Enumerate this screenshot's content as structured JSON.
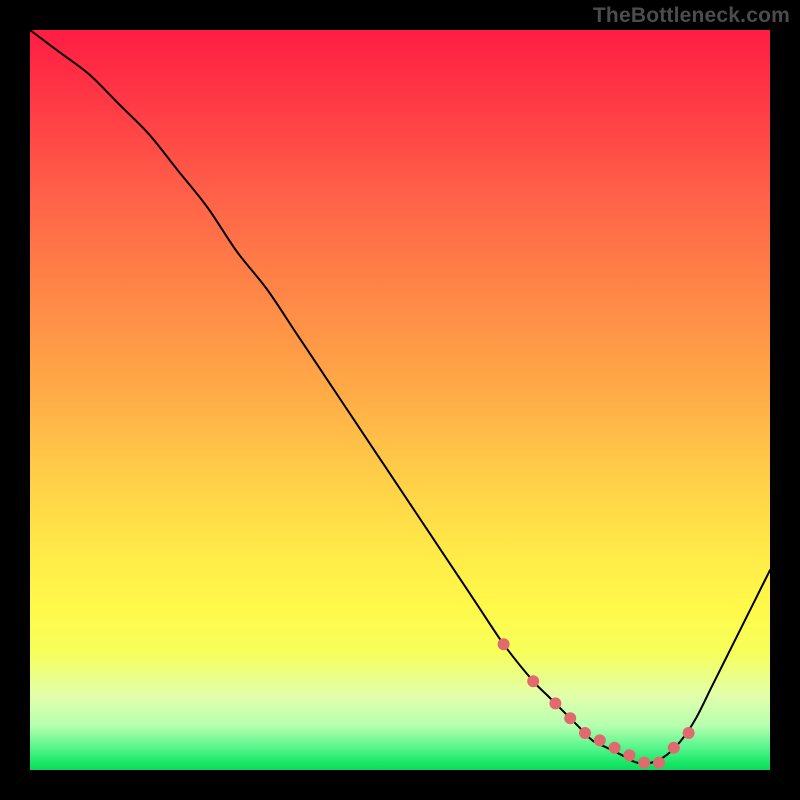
{
  "watermark": "TheBottleneck.com",
  "colors": {
    "frame_bg": "#000000",
    "curve_stroke": "#000000",
    "marker_fill": "#e06a6d",
    "gradient_top": "#ff1d44",
    "gradient_bottom": "#0fd95c"
  },
  "chart_data": {
    "type": "line",
    "title": "",
    "xlabel": "",
    "ylabel": "",
    "xlim": [
      0,
      100
    ],
    "ylim": [
      0,
      100
    ],
    "grid": false,
    "legend": false,
    "annotations": [],
    "series": [
      {
        "name": "bottleneck-curve",
        "x": [
          0,
          4,
          8,
          12,
          16,
          20,
          24,
          28,
          32,
          36,
          40,
          44,
          48,
          52,
          56,
          60,
          64,
          68,
          70,
          72,
          74,
          76,
          78,
          80,
          82,
          84,
          86,
          88,
          90,
          92,
          94,
          96,
          98,
          100
        ],
        "values": [
          100,
          97,
          94,
          90,
          86,
          81,
          76,
          70,
          65,
          59,
          53,
          47,
          41,
          35,
          29,
          23,
          17,
          12,
          10,
          8,
          6,
          4,
          3,
          2,
          1,
          1,
          2,
          4,
          7,
          11,
          15,
          19,
          23,
          27
        ]
      }
    ],
    "markers": {
      "name": "highlight-cluster",
      "x": [
        64,
        68,
        71,
        73,
        75,
        77,
        79,
        81,
        83,
        85,
        87,
        89
      ],
      "values": [
        17,
        12,
        9,
        7,
        5,
        4,
        3,
        2,
        1,
        1,
        3,
        5
      ]
    }
  }
}
